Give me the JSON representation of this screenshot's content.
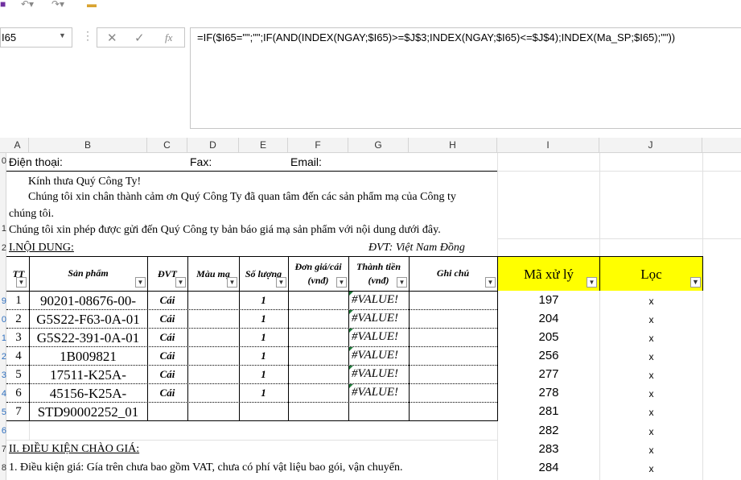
{
  "toolbar": {
    "icons": [
      "save-icon",
      "undo-icon",
      "redo-icon",
      "open-folder-icon"
    ]
  },
  "name_box": {
    "value": "I65"
  },
  "formula_bar": {
    "formula": "=IF($I65=\"\";\"\";IF(AND(INDEX(NGAY;$I65)>=$J$3;INDEX(NGAY;$I65)<=$J$4);INDEX(Ma_SP;$I65);\"\"))"
  },
  "columns": [
    "A",
    "B",
    "C",
    "D",
    "E",
    "F",
    "G",
    "H",
    "I",
    "J"
  ],
  "rows": [
    "0",
    "",
    "",
    "1",
    "",
    "2",
    "",
    "9",
    "0",
    "1",
    "2",
    "3",
    "4",
    "5",
    "6",
    "7",
    "8"
  ],
  "contact": {
    "phone": "Điện thoại:",
    "fax": "Fax:",
    "email": "Email:"
  },
  "letter": {
    "line1": "Kính thưa Quý Công Ty!",
    "line2": "Chúng tôi xin chân thành cảm ơn Quý Công Ty đã quan tâm đến các sản phẩm mạ của Công ty",
    "line3": "chúng tôi.",
    "line4": "Chúng tôi xin phép được gửi đến Quý Công ty bản báo giá mạ sản phẩm với nội dung dưới đây."
  },
  "section1": {
    "title": "I.NỘI DUNG:",
    "unit": "ĐVT: Việt Nam Đồng"
  },
  "table": {
    "headers": {
      "tt": "TT",
      "product": "Sản phẩm",
      "unit": "ĐVT",
      "color": "Màu mạ",
      "qty": "Số lượng",
      "price": "Đơn giá/cái (vnđ)",
      "amount": "Thành tiền (vnđ)",
      "note": "Ghi chú",
      "code": "Mã xử lý",
      "filter": "Lọc"
    },
    "rows": [
      {
        "tt": "1",
        "product": "90201-08676-00-",
        "unit": "Cái",
        "qty": "1",
        "amount": "#VALUE!",
        "code": "197",
        "filter": "x"
      },
      {
        "tt": "2",
        "product": "G5S22-F63-0A-01",
        "unit": "Cái",
        "qty": "1",
        "amount": "#VALUE!",
        "code": "204",
        "filter": "x"
      },
      {
        "tt": "3",
        "product": "G5S22-391-0A-01",
        "unit": "Cái",
        "qty": "1",
        "amount": "#VALUE!",
        "code": "205",
        "filter": "x"
      },
      {
        "tt": "4",
        "product": "1B009821",
        "unit": "Cái",
        "qty": "1",
        "amount": "#VALUE!",
        "code": "256",
        "filter": "x"
      },
      {
        "tt": "5",
        "product": "17511-K25A-",
        "unit": "Cái",
        "qty": "1",
        "amount": "#VALUE!",
        "code": "277",
        "filter": "x"
      },
      {
        "tt": "6",
        "product": "45156-K25A-",
        "unit": "Cái",
        "qty": "1",
        "amount": "#VALUE!",
        "code": "278",
        "filter": "x"
      },
      {
        "tt": "7",
        "product": "STD90002252_01",
        "unit": "",
        "qty": "",
        "amount": "",
        "code": "281",
        "filter": "x"
      }
    ]
  },
  "extra_rows": [
    {
      "code": "282",
      "filter": "x"
    },
    {
      "code": "283",
      "filter": "x"
    },
    {
      "code": "284",
      "filter": "x"
    }
  ],
  "section2": {
    "title": "II. ĐIỀU KIỆN CHÀO GIÁ:",
    "line1": "1. Điều kiện giá: Gía trên chưa bao gồm VAT, chưa có phí vật liệu bao gói, vận chuyển."
  },
  "colors": {
    "highlight": "#ffff00",
    "error_marker": "#1f7a3a"
  }
}
